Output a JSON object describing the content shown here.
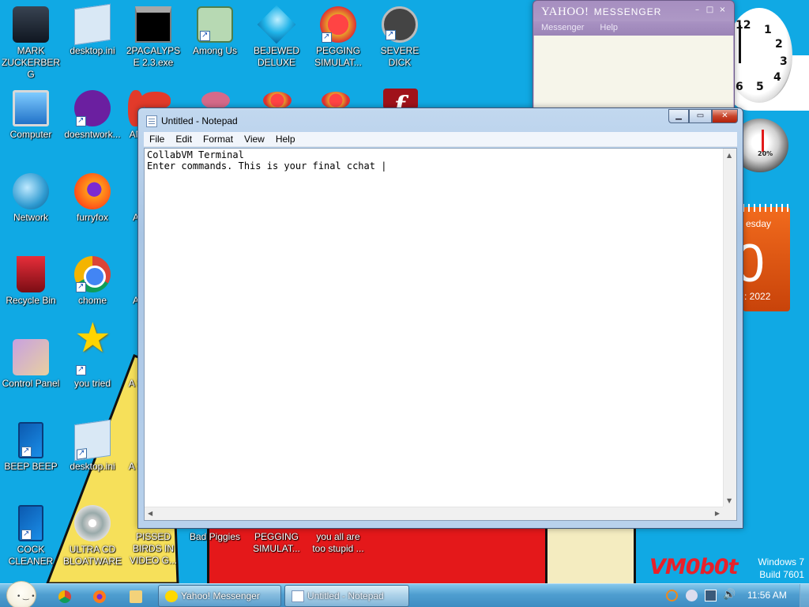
{
  "desktop": {
    "icons_col1": [
      {
        "label": "MARK ZUCKERBERG",
        "icon": "mark-zuckerberg-icon"
      },
      {
        "label": "Computer",
        "icon": "computer-icon"
      },
      {
        "label": "Network",
        "icon": "network-icon"
      },
      {
        "label": "Recycle Bin",
        "icon": "recycle-bin-icon"
      },
      {
        "label": "Control Panel",
        "icon": "control-panel-icon"
      },
      {
        "label": "BEEP BEEP",
        "icon": "beep-beep-icon"
      },
      {
        "label": "COCK CLEANER",
        "icon": "cleaner-icon"
      }
    ],
    "icons_col2": [
      {
        "label": "desktop.ini",
        "icon": "ini-file-icon"
      },
      {
        "label": "doesntwork...",
        "icon": "yahoo-messenger-icon"
      },
      {
        "label": "furryfox",
        "icon": "firefox-icon"
      },
      {
        "label": "chome",
        "icon": "chrome-icon"
      },
      {
        "label": "you tried",
        "icon": "star-icon"
      },
      {
        "label": "desktop.ini",
        "icon": "ini-file-icon"
      },
      {
        "label": "ULTRA CD BLOATWARE",
        "icon": "cd-icon"
      }
    ],
    "icons_col3_partial": [
      {
        "label": "AN",
        "icon": "angry-birds-icon"
      },
      {
        "label": "A",
        "icon": "app-icon"
      },
      {
        "label": "A",
        "icon": "app-icon"
      },
      {
        "label": "A S",
        "icon": "app-icon"
      },
      {
        "label": "A S",
        "icon": "app-icon"
      }
    ],
    "icons_top_row": [
      {
        "label": "2PACALYPSE 2.3.exe",
        "icon": "cmd-icon"
      },
      {
        "label": "Among Us",
        "icon": "among-us-icon"
      },
      {
        "label": "BEJEWED DELUXE",
        "icon": "gem-icon"
      },
      {
        "label": "PEGGING SIMULAT...",
        "icon": "pegging-icon"
      },
      {
        "label": "SEVERE DICK",
        "icon": "sd-icon"
      }
    ],
    "icons_bottom_row": [
      {
        "label": "PISSED BIRDS IN VIDEO G...",
        "icon": "angry-birds-icon"
      },
      {
        "label": "Bad Piggies",
        "icon": "pig-icon"
      },
      {
        "label": "PEGGING SIMULAT...",
        "icon": "pegging-icon"
      },
      {
        "label": "you all are too stupid ...",
        "icon": "tear-icon"
      }
    ],
    "watermark": "VM0b0t",
    "os_name": "Windows 7",
    "build": "Build 7601"
  },
  "gadgets": {
    "clock_numbers": [
      "12",
      "1",
      "2",
      "3",
      "4",
      "5",
      "6"
    ],
    "cpu_meter": "20%",
    "calendar_day": "esday",
    "calendar_date": "0",
    "calendar_year": ": 2022"
  },
  "yahoo": {
    "title_logo": "YAHOO!",
    "title_text": "MESSENGER",
    "menu": [
      "Messenger",
      "Help"
    ]
  },
  "notepad": {
    "title": "Untitled - Notepad",
    "menu": [
      "File",
      "Edit",
      "Format",
      "View",
      "Help"
    ],
    "content": "CollabVM Terminal\nEnter commands. This is your final cchat |"
  },
  "taskbar": {
    "buttons": [
      {
        "label": "Yahoo! Messenger",
        "icon": "yahoo-messenger-icon"
      },
      {
        "label": "Untitled - Notepad",
        "icon": "notepad-icon"
      }
    ],
    "time": "11:56 AM"
  },
  "colors": {
    "desktop_bg": "#10a9e4",
    "taskbar": "#4f9ed0",
    "watermark": "#e8202a",
    "close_button": "#c8452c"
  }
}
